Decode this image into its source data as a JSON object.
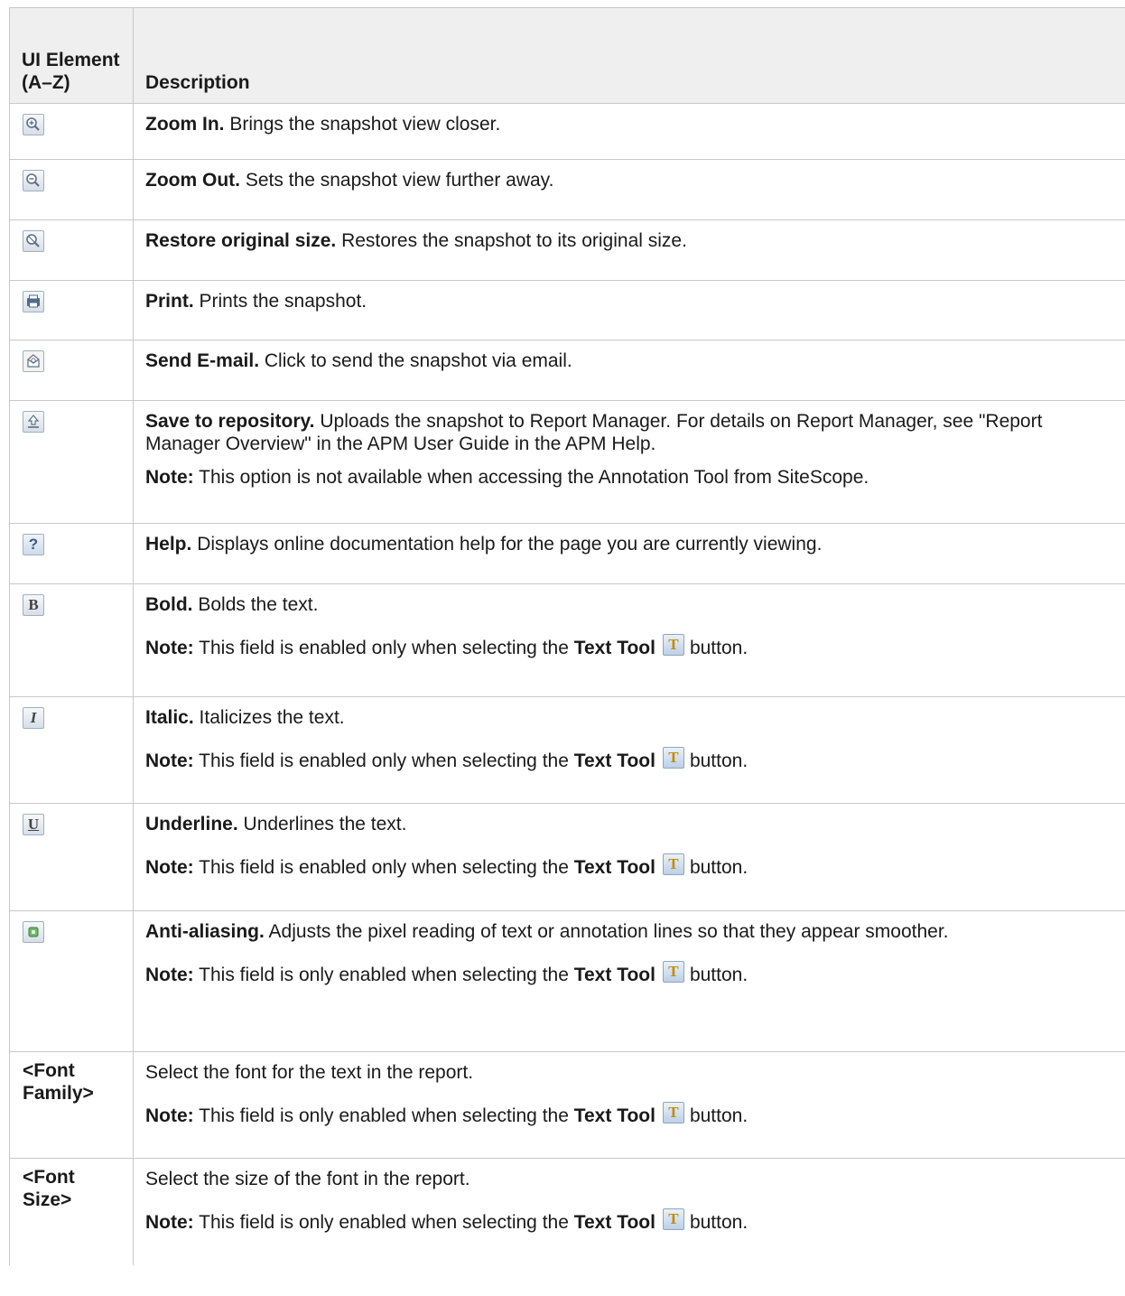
{
  "table": {
    "header": {
      "col1": "UI Element (A–Z)",
      "col2": "Description"
    },
    "rows": [
      {
        "icon": "zoom-in-icon",
        "title": "Zoom In.",
        "desc": "Brings the snapshot view closer."
      },
      {
        "icon": "zoom-out-icon",
        "title": "Zoom Out.",
        "desc": "Sets the snapshot view further away."
      },
      {
        "icon": "restore-size-icon",
        "title": "Restore original size.",
        "desc": "Restores the snapshot to its original size."
      },
      {
        "icon": "print-icon",
        "title": "Print.",
        "desc": "Prints the snapshot."
      },
      {
        "icon": "send-email-icon",
        "title": "Send E-mail.",
        "desc": "Click to send the snapshot via email."
      },
      {
        "icon": "save-repository-icon",
        "title": "Save to repository.",
        "desc": "Uploads the snapshot to Report Manager. For details on Report Manager, see \"Report Manager Overview\" in the APM User Guide in the APM Help.",
        "note_label": "Note:",
        "note": "This option is not available when accessing the Annotation Tool from SiteScope."
      },
      {
        "icon": "help-icon",
        "glyph": "?",
        "title": "Help.",
        "desc": "Displays online documentation help for the page you are currently viewing."
      },
      {
        "icon": "bold-icon",
        "glyph": "B",
        "title": "Bold.",
        "desc": "Bolds the text.",
        "note_label": "Note:",
        "note_pre": "This field is enabled only when selecting the",
        "note_tool": "Text Tool",
        "note_post": "button."
      },
      {
        "icon": "italic-icon",
        "glyph": "I",
        "title": "Italic.",
        "desc": "Italicizes the text.",
        "note_label": "Note:",
        "note_pre": "This field is enabled only when selecting the",
        "note_tool": "Text Tool",
        "note_post": "button."
      },
      {
        "icon": "underline-icon",
        "glyph": "U",
        "title": "Underline.",
        "desc": "Underlines the text.",
        "note_label": "Note:",
        "note_pre": "This field is enabled only when selecting the",
        "note_tool": "Text Tool",
        "note_post": "button."
      },
      {
        "icon": "anti-aliasing-icon",
        "title": "Anti-aliasing.",
        "desc": "Adjusts the pixel reading of text or annotation lines so that they appear smoother.",
        "note_label": "Note:",
        "note_pre": "This field is only enabled when selecting the",
        "note_tool": "Text Tool",
        "note_post": "button."
      },
      {
        "element": "<Font Family>",
        "desc": "Select the font for the text in the report.",
        "note_label": "Note:",
        "note_pre": "This field is only enabled when selecting the",
        "note_tool": "Text Tool",
        "note_post": "button."
      },
      {
        "element": "<Font Size>",
        "desc": "Select the size of the font in the report.",
        "note_label": "Note:",
        "note_pre": "This field is only enabled when selecting the",
        "note_tool": "Text Tool",
        "note_post": "button."
      }
    ],
    "text_tool_glyph": "T"
  }
}
